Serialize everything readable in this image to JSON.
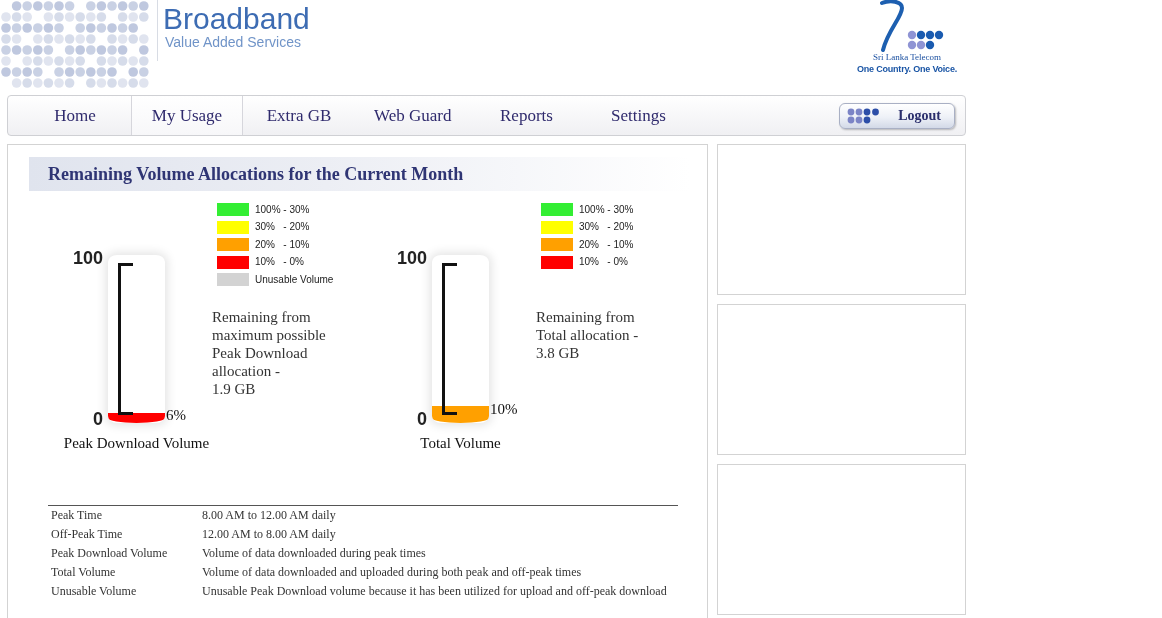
{
  "header": {
    "brand": {
      "title": "Broadband",
      "subtitle": "Value Added Services"
    },
    "partner": {
      "name": "Sri Lanka Telecom",
      "slogan": "One Country. One Voice."
    }
  },
  "nav": {
    "items": [
      {
        "label": "Home",
        "selected": false
      },
      {
        "label": "My Usage",
        "selected": true
      },
      {
        "label": "Extra GB",
        "selected": false
      },
      {
        "label": "Web Guard",
        "selected": false
      },
      {
        "label": "Reports",
        "selected": false
      },
      {
        "label": "Settings",
        "selected": false
      }
    ],
    "logout_button": "Logout"
  },
  "main": {
    "heading": "Remaining Volume Allocations for the Current Month",
    "gauges": [
      {
        "title": "Peak Download Volume",
        "scale_max": "100",
        "scale_min": "0",
        "level": 0.06,
        "reading": "6%",
        "color": "#ff0000",
        "legend": [
          {
            "label": "100% - 30%",
            "color": "#33ee33"
          },
          {
            "label": "30%   - 20%",
            "color": "#ffff00"
          },
          {
            "label": "20%   - 10%",
            "color": "#ffa000"
          },
          {
            "label": "10%   - 0%",
            "color": "#ff0000"
          },
          {
            "label": "Unusable Volume",
            "color": "#d3d3d3"
          }
        ],
        "description": "Remaining from maximum possible Peak Download allocation -",
        "amount": "1.9 GB"
      },
      {
        "title": "Total Volume",
        "scale_max": "100",
        "scale_min": "0",
        "level": 0.1,
        "reading": "10%",
        "color": "#ffa000",
        "legend": [
          {
            "label": "100% - 30%",
            "color": "#33ee33"
          },
          {
            "label": "30%   - 20%",
            "color": "#ffff00"
          },
          {
            "label": "20%   - 10%",
            "color": "#ffa000"
          },
          {
            "label": "10%   - 0%",
            "color": "#ff0000"
          }
        ],
        "description": "Remaining from Total allocation -",
        "amount": "3.8 GB"
      }
    ],
    "definitions": [
      {
        "term": "Peak Time",
        "description": "8.00 AM to 12.00 AM daily"
      },
      {
        "term": "Off-Peak Time",
        "description": "12.00 AM to 8.00 AM daily"
      },
      {
        "term": "Peak Download Volume",
        "description": "Volume of data downloaded during peak times"
      },
      {
        "term": "Total Volume",
        "description": "Volume of data downloaded and uploaded during both peak and off-peak times"
      },
      {
        "term": "Unusable Volume",
        "description": "Unusable Peak Download volume because it has been utilized for upload and off-peak download"
      }
    ]
  }
}
